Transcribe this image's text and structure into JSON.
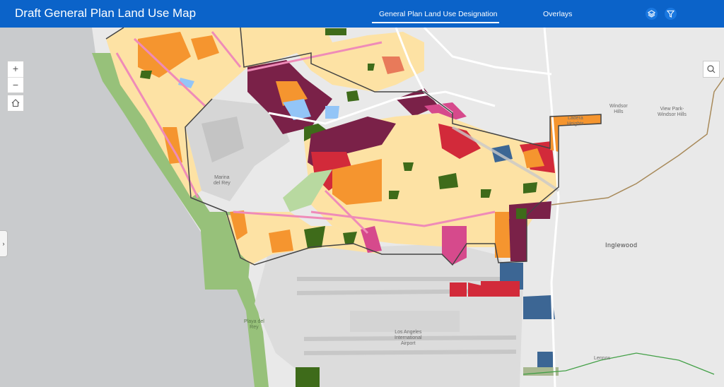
{
  "header": {
    "title": "Draft General Plan Land Use Map",
    "tabs": [
      {
        "label": "General Plan Land Use Designation",
        "active": true
      },
      {
        "label": "Overlays",
        "active": false
      }
    ],
    "buttons": {
      "layers_icon": "layers-icon",
      "filter_icon": "filter-icon"
    }
  },
  "controls": {
    "zoom_in": "+",
    "zoom_out": "−",
    "home_icon": "home-icon",
    "search_icon": "search-icon",
    "panel_toggle": "›"
  },
  "map_labels": {
    "marina": "Marina\ndel Rey",
    "ladera": "Ladera\nHeights",
    "windsor_hills": "Windsor\nHills",
    "view_park": "View Park-\nWindsor Hills",
    "inglewood": "Inglewood",
    "lax": "Los Angeles\nInternational\nAirport",
    "lennox": "Lennox",
    "playa": "Playa del\nRey"
  },
  "colors": {
    "header": "#0b63c9",
    "ocean": "#c9cbcd",
    "beach": "#97c17a",
    "single_family": "#fde2a4",
    "multi_family": "#f5952f",
    "commercial": "#d22a3a",
    "mixed_use": "#7a2148",
    "mixed_use_pink": "#d64a8c",
    "open_space": "#3e6b1a",
    "public_facility": "#93c5f7",
    "industrial": "#3c6694"
  }
}
